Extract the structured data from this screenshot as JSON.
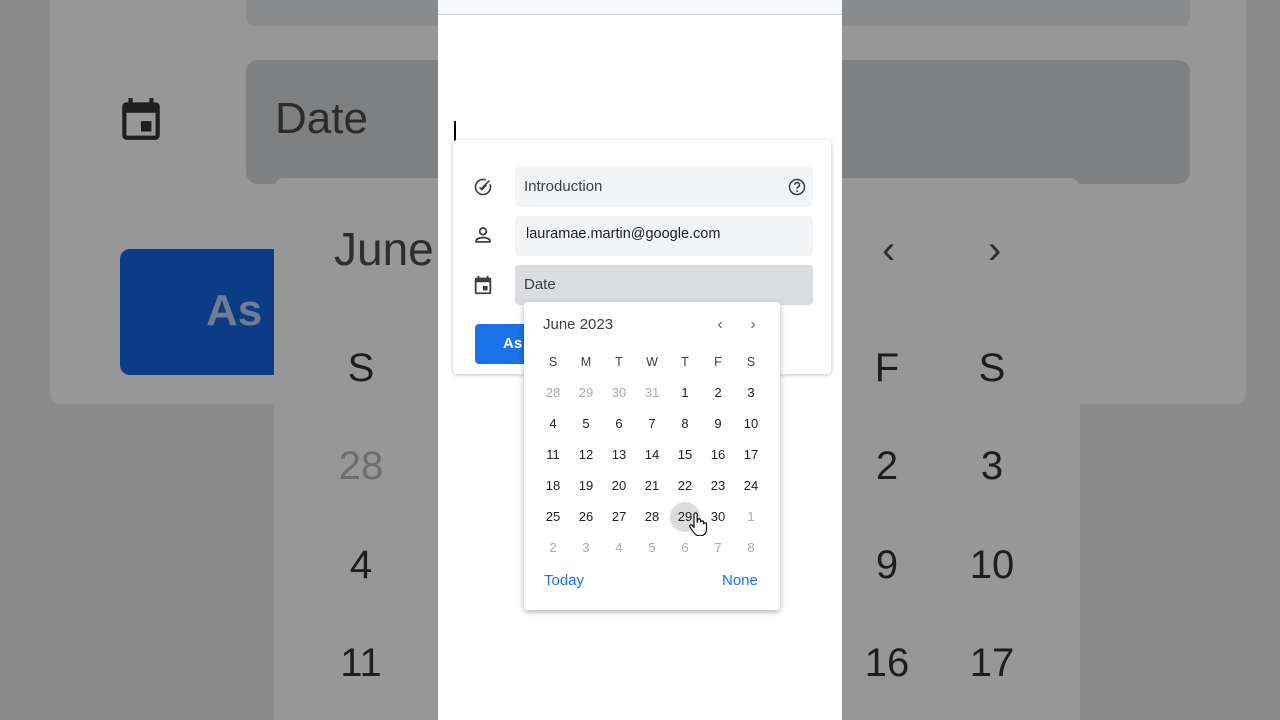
{
  "background": {
    "date_label": "Date",
    "assign_label": "As",
    "month_label": "June",
    "nav_prev": "‹",
    "nav_next": "›",
    "weekday_left": "S",
    "weekday_f": "F",
    "weekday_s": "S",
    "numbers": {
      "n28": "28",
      "n2": "2",
      "n3": "3",
      "n4": "4",
      "n9": "9",
      "n10": "10",
      "n11": "11",
      "n16": "16",
      "n17": "17"
    }
  },
  "form": {
    "title_field": {
      "value": "Introduction",
      "icon": "check-circle-icon",
      "help_icon": "help-icon"
    },
    "assignee_field": {
      "value": "lauramae.martin@google.com",
      "icon": "person-icon"
    },
    "date_field": {
      "placeholder": "Date",
      "icon": "calendar-icon"
    },
    "assign_button": "As"
  },
  "date_picker": {
    "month_label": "June 2023",
    "prev_label": "‹",
    "next_label": "›",
    "weekdays": [
      "S",
      "M",
      "T",
      "W",
      "T",
      "F",
      "S"
    ],
    "weeks": [
      [
        "28",
        "29",
        "30",
        "31",
        "1",
        "2",
        "3"
      ],
      [
        "4",
        "5",
        "6",
        "7",
        "8",
        "9",
        "10"
      ],
      [
        "11",
        "12",
        "13",
        "14",
        "15",
        "16",
        "17"
      ],
      [
        "18",
        "19",
        "20",
        "21",
        "22",
        "23",
        "24"
      ],
      [
        "25",
        "26",
        "27",
        "28",
        "29",
        "30",
        "1"
      ],
      [
        "2",
        "3",
        "4",
        "5",
        "6",
        "7",
        "8"
      ]
    ],
    "hovered_day": "29",
    "today_label": "Today",
    "none_label": "None"
  },
  "colors": {
    "accent": "#1a73e8",
    "field_bg": "#f1f3f4",
    "date_field_bg": "#dadce0",
    "muted_day": "#a8abaf"
  }
}
